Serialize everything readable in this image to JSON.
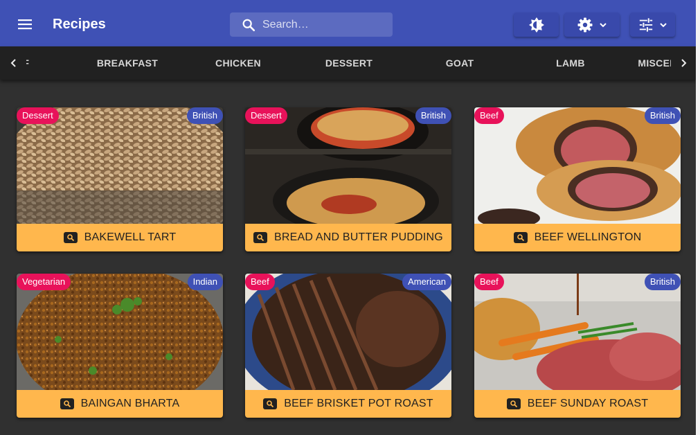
{
  "app": {
    "title": "Recipes"
  },
  "search": {
    "placeholder": "Search…",
    "icon": "search-icon"
  },
  "toolbar": {
    "theme_icon": "brightness-icon",
    "settings_icon": "gear-icon",
    "filter_icon": "tune-icon"
  },
  "categories": {
    "prev_icon": "chevron-left-icon",
    "next_icon": "chevron-right-icon",
    "items": [
      {
        "label": "BEEF"
      },
      {
        "label": "BREAKFAST"
      },
      {
        "label": "CHICKEN"
      },
      {
        "label": "DESSERT"
      },
      {
        "label": "GOAT"
      },
      {
        "label": "LAMB"
      },
      {
        "label": "MISCELLANEOUS"
      }
    ]
  },
  "recipes": [
    {
      "name": "BAKEWELL TART",
      "category": "Dessert",
      "area": "British"
    },
    {
      "name": "BREAD AND BUTTER PUDDING",
      "category": "Dessert",
      "area": "British"
    },
    {
      "name": "BEEF WELLINGTON",
      "category": "Beef",
      "area": "British"
    },
    {
      "name": "BAINGAN BHARTA",
      "category": "Vegetarian",
      "area": "Indian"
    },
    {
      "name": "BEEF BRISKET POT ROAST",
      "category": "Beef",
      "area": "American"
    },
    {
      "name": "BEEF SUNDAY ROAST",
      "category": "Beef",
      "area": "British"
    }
  ],
  "colors": {
    "primary": "#3f51b5",
    "background": "#303030",
    "tab_bar": "#212121",
    "caption": "#ffb74d",
    "category_badge": "#e8125a",
    "area_badge": "#3f51b5"
  }
}
